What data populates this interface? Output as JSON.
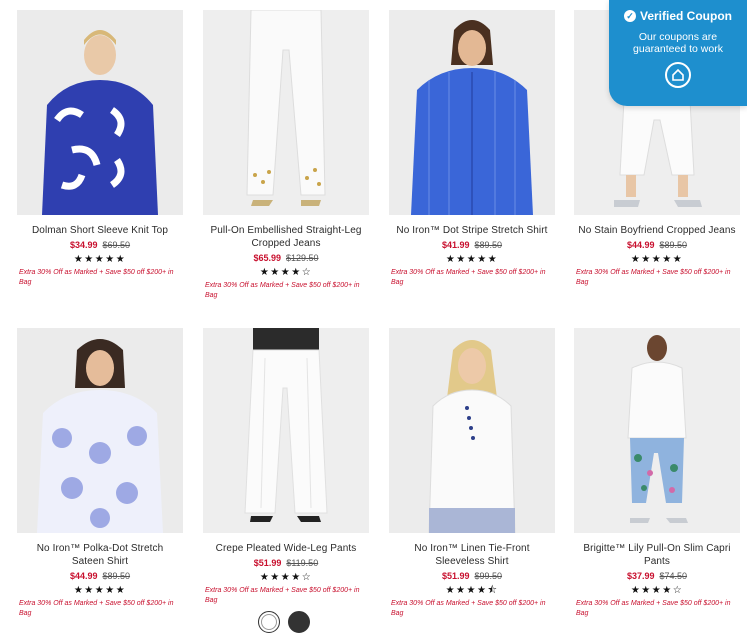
{
  "products": [
    {
      "name": "Dolman Short Sleeve Knit Top",
      "sale": "$34.99",
      "orig": "$69.50",
      "stars": "★★★★★",
      "promo": "Extra 30% Off as Marked + Save $50 off $200+ in Bag"
    },
    {
      "name": "Pull-On Embellished Straight-Leg Cropped Jeans",
      "sale": "$65.99",
      "orig": "$129.50",
      "stars": "★★★★☆",
      "promo": "Extra 30% Off as Marked + Save $50 off $200+ in Bag"
    },
    {
      "name": "No Iron™ Dot Stripe Stretch Shirt",
      "sale": "$41.99",
      "orig": "$89.50",
      "stars": "★★★★★",
      "promo": "Extra 30% Off as Marked + Save $50 off $200+ in Bag"
    },
    {
      "name": "No Stain Boyfriend Cropped Jeans",
      "sale": "$44.99",
      "orig": "$89.50",
      "stars": "★★★★★",
      "promo": "Extra 30% Off as Marked + Save $50 off $200+ in Bag"
    },
    {
      "name": "No Iron™ Polka-Dot Stretch Sateen Shirt",
      "sale": "$44.99",
      "orig": "$89.50",
      "stars": "★★★★★",
      "promo": "Extra 30% Off as Marked + Save $50 off $200+ in Bag"
    },
    {
      "name": "Crepe Pleated Wide-Leg Pants",
      "sale": "$51.99",
      "orig": "$119.50",
      "stars": "★★★★☆",
      "promo": "Extra 30% Off as Marked + Save $50 off $200+ in Bag"
    },
    {
      "name": "No Iron™ Linen Tie-Front Sleeveless Shirt",
      "sale": "$51.99",
      "orig": "$99.50",
      "stars": "★★★★⯪",
      "promo": "Extra 30% Off as Marked + Save $50 off $200+ in Bag"
    },
    {
      "name": "Brigitte™ Lily Pull-On Slim Capri Pants",
      "sale": "$37.99",
      "orig": "$74.50",
      "stars": "★★★★☆",
      "promo": "Extra 30% Off as Marked + Save $50 off $200+ in Bag"
    }
  ],
  "coupon": {
    "title": "Verified Coupon",
    "subtitle": "Our coupons are guaranteed to work",
    "check_icon": "check-circle-icon",
    "logo_icon": "house-logo-icon"
  },
  "swatches": [
    {
      "color": "white",
      "icon": "swatch-white"
    },
    {
      "color": "black",
      "icon": "swatch-black"
    }
  ],
  "colors": {
    "sale": "#c8102e",
    "coupon_bg": "#1e8fce"
  }
}
